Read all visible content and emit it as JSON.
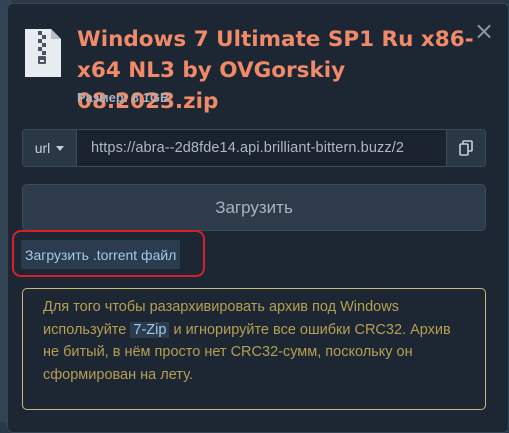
{
  "dialog": {
    "close_label": "×",
    "title": "Windows 7 Ultimate SP1 Ru x86-x64 NL3 by OVGorskiy 08.2023.zip",
    "size_label": "Размер:",
    "size_value": "8.1GB"
  },
  "url_bar": {
    "type_label": "url",
    "value": "https://abra--2d8fde14.api.brilliant-bittern.buzz/2",
    "copy_icon": "copy-icon"
  },
  "download_button_label": "Загрузить",
  "torrent_link_label": "Загрузить .torrent файл",
  "notice": {
    "part1": "Для того чтобы разархивировать архив под Windows используйте",
    "link": "7-Zip",
    "part2": "и игнорируйте все ошибки CRC32. Архив не битый, в нём просто нет CRC32-сумм, поскольку он сформирован на лету."
  },
  "colors": {
    "title": "#f08a68",
    "highlight_ring": "#d81e2b",
    "notice_text": "#b69e53",
    "notice_border": "#c8b97c",
    "link": "#a3c9ea"
  }
}
